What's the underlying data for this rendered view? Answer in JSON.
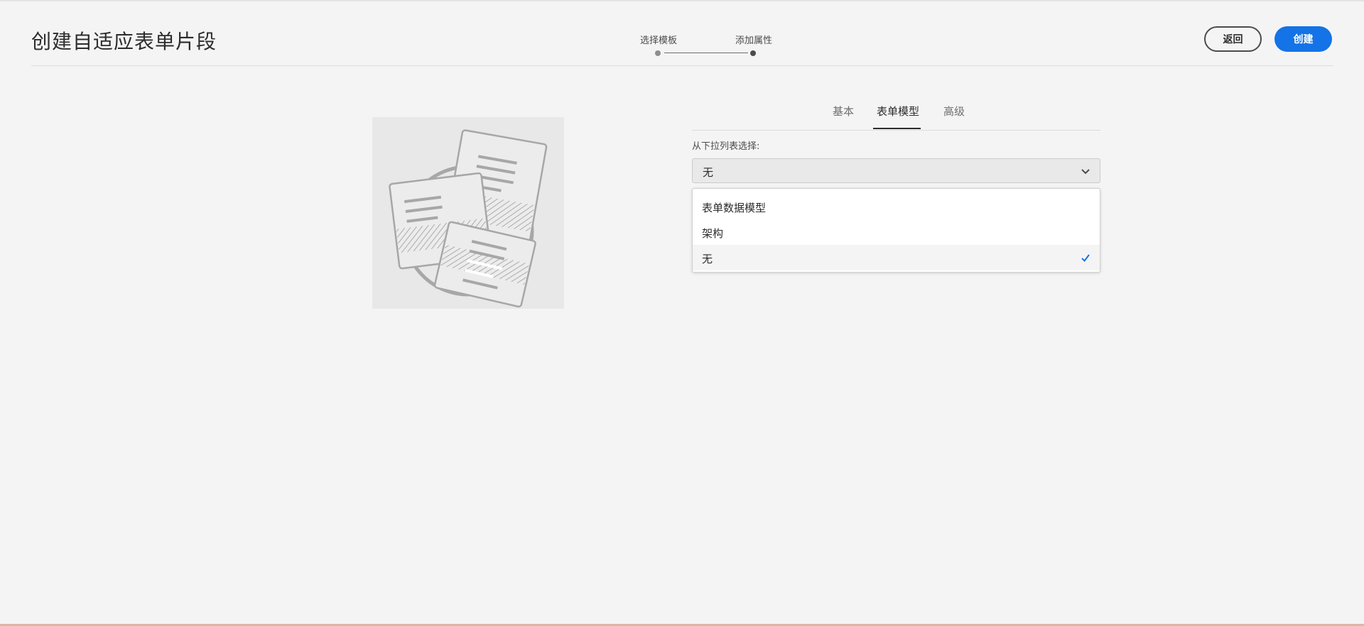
{
  "header": {
    "title": "创建自适应表单片段",
    "steps": [
      "选择模板",
      "添加属性"
    ],
    "back_label": "返回",
    "create_label": "创建"
  },
  "tabs": [
    {
      "label": "基本",
      "active": false
    },
    {
      "label": "表单模型",
      "active": true
    },
    {
      "label": "高级",
      "active": false
    }
  ],
  "form": {
    "field_label": "从下拉列表选择:",
    "selected_value": "无",
    "options": [
      "表单数据模型",
      "架构",
      "无"
    ]
  },
  "colors": {
    "accent": "#1473e6",
    "background": "#f4f4f4",
    "text": "#2c2c2c"
  },
  "icons": [
    "chevron-down-icon",
    "checkmark-icon",
    "form-fragment-illustration"
  ]
}
